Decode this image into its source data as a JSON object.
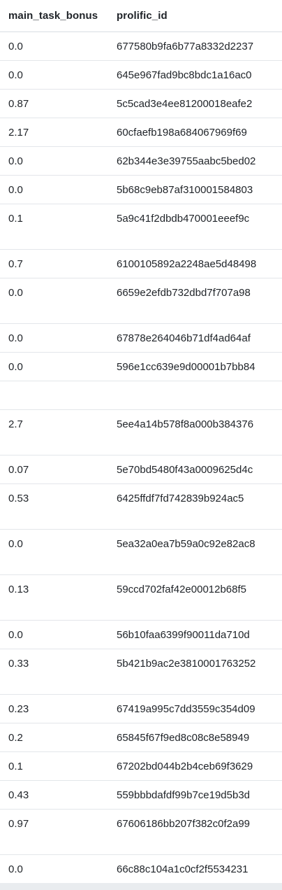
{
  "table": {
    "columns": [
      {
        "key": "main_task_bonus",
        "label": "main_task_bonus"
      },
      {
        "key": "prolific_id",
        "label": "prolific_id"
      }
    ],
    "rows": [
      {
        "main_task_bonus": "0.0",
        "prolific_id": "677580b9fa6b77a8332d2237",
        "tall": false
      },
      {
        "main_task_bonus": "0.0",
        "prolific_id": "645e967fad9bc8bdc1a16ac0",
        "tall": false
      },
      {
        "main_task_bonus": "0.87",
        "prolific_id": "5c5cad3e4ee81200018eafe2",
        "tall": false
      },
      {
        "main_task_bonus": "2.17",
        "prolific_id": "60cfaefb198a684067969f69",
        "tall": false
      },
      {
        "main_task_bonus": "0.0",
        "prolific_id": "62b344e3e39755aabc5bed02",
        "tall": false
      },
      {
        "main_task_bonus": "0.0",
        "prolific_id": "5b68c9eb87af310001584803",
        "tall": false
      },
      {
        "main_task_bonus": "0.1",
        "prolific_id": "5a9c41f2dbdb470001eeef9c",
        "tall": true
      },
      {
        "main_task_bonus": "0.7",
        "prolific_id": "6100105892a2248ae5d48498",
        "tall": false
      },
      {
        "main_task_bonus": "0.0",
        "prolific_id": "6659e2efdb732dbd7f707a98",
        "tall": true
      },
      {
        "main_task_bonus": "0.0",
        "prolific_id": "67878e264046b71df4ad64af",
        "tall": false
      },
      {
        "main_task_bonus": "0.0",
        "prolific_id": "596e1cc639e9d00001b7bb84",
        "tall": false
      },
      {
        "main_task_bonus": "",
        "prolific_id": "",
        "tall": false
      },
      {
        "main_task_bonus": "2.7",
        "prolific_id": "5ee4a14b578f8a000b384376",
        "tall": true
      },
      {
        "main_task_bonus": "0.07",
        "prolific_id": "5e70bd5480f43a0009625d4c",
        "tall": false
      },
      {
        "main_task_bonus": "0.53",
        "prolific_id": "6425ffdf7fd742839b924ac5",
        "tall": true
      },
      {
        "main_task_bonus": "0.0",
        "prolific_id": "5ea32a0ea7b59a0c92e82ac8",
        "tall": true
      },
      {
        "main_task_bonus": "0.13",
        "prolific_id": "59ccd702faf42e00012b68f5",
        "tall": true
      },
      {
        "main_task_bonus": "0.0",
        "prolific_id": "56b10faa6399f90011da710d",
        "tall": false
      },
      {
        "main_task_bonus": "0.33",
        "prolific_id": "5b421b9ac2e3810001763252",
        "tall": true
      },
      {
        "main_task_bonus": "0.23",
        "prolific_id": "67419a995c7dd3559c354d09",
        "tall": false
      },
      {
        "main_task_bonus": "0.2",
        "prolific_id": "65845f67f9ed8c08c8e58949",
        "tall": false
      },
      {
        "main_task_bonus": "0.1",
        "prolific_id": "67202bd044b2b4ceb69f3629",
        "tall": false
      },
      {
        "main_task_bonus": "0.43",
        "prolific_id": "559bbbdafdf99b7ce19d5b3d",
        "tall": false
      },
      {
        "main_task_bonus": "0.97",
        "prolific_id": "67606186bb207f382c0f2a99",
        "tall": true
      },
      {
        "main_task_bonus": "0.0",
        "prolific_id": "66c88c104a1c0cf2f5534231",
        "tall": false
      }
    ]
  }
}
